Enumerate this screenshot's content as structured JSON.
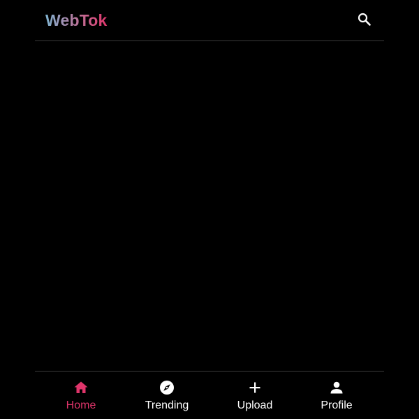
{
  "header": {
    "logo_text": "WebTok",
    "search_icon": "search-icon"
  },
  "feed": {
    "items": []
  },
  "bottom_nav": {
    "items": [
      {
        "label": "Home",
        "icon": "home-icon",
        "active": true
      },
      {
        "label": "Trending",
        "icon": "compass-icon",
        "active": false
      },
      {
        "label": "Upload",
        "icon": "plus-icon",
        "active": false
      },
      {
        "label": "Profile",
        "icon": "person-icon",
        "active": false
      }
    ]
  },
  "colors": {
    "background": "#000000",
    "accent": "#e0356b",
    "text": "#ffffff",
    "divider": "#3a3a3a",
    "logo_gradient_start": "#7fb3d0",
    "logo_gradient_end": "#e0356b"
  }
}
